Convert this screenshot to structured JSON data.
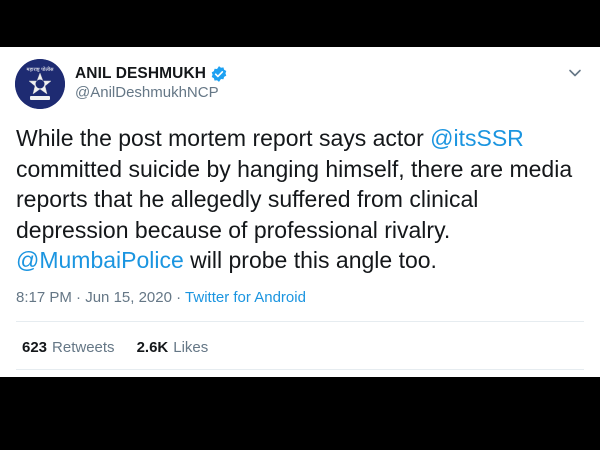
{
  "author": {
    "display_name": "ANIL DESHMUKH",
    "handle": "@AnilDeshmukhNCP",
    "verified": true,
    "avatar_icon": "police-emblem-icon",
    "avatar_text": "महाराष्ट्र पोलीस"
  },
  "tweet": {
    "text_part1": "While the post mortem report says actor ",
    "mention1": "@itsSSR",
    "text_part2": " committed suicide by hanging himself, there are media reports that  he allegedly suffered from clinical depression because of professional rivalry. ",
    "mention2": "@MumbaiPolice",
    "text_part3": " will probe this angle too."
  },
  "meta": {
    "time": "8:17 PM",
    "separator1": " · ",
    "date": "Jun 15, 2020",
    "separator2": " · ",
    "source": "Twitter for Android"
  },
  "stats": {
    "retweets_count": "623",
    "retweets_label": "Retweets",
    "likes_count": "2.6K",
    "likes_label": "Likes"
  },
  "colors": {
    "link": "#1b95e0",
    "verified": "#1da1f2",
    "text": "#14171a",
    "secondary": "#657786"
  }
}
